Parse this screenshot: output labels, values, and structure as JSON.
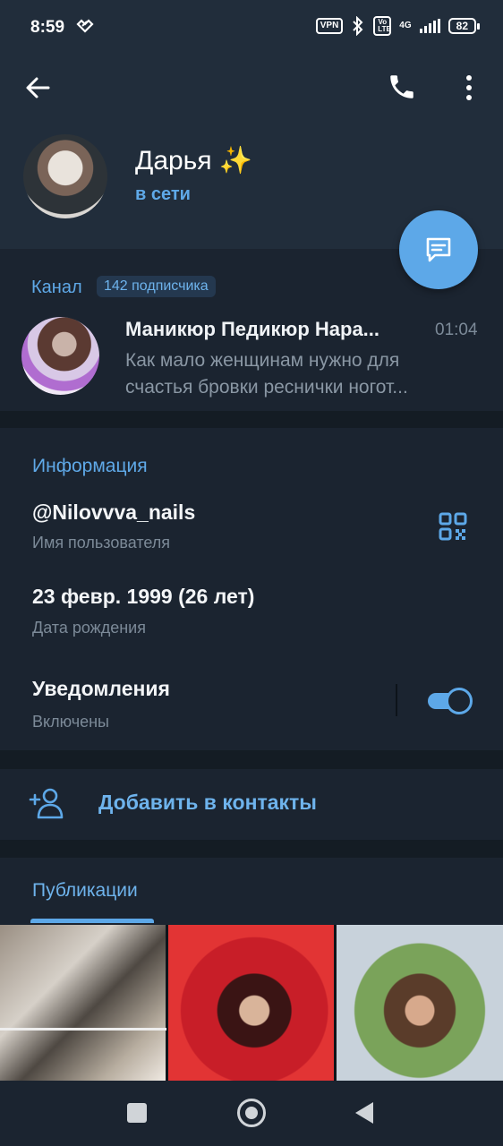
{
  "status_bar": {
    "time": "8:59",
    "vpn": "VPN",
    "volte": "Vo LTE",
    "network": "4G",
    "battery": "82"
  },
  "header": {
    "name": "Дарья ✨",
    "status": "в сети",
    "icons": [
      "back-arrow-icon",
      "phone-icon",
      "more-vert-icon",
      "message-icon"
    ],
    "accent": "#5da8e8"
  },
  "channel": {
    "label": "Канал",
    "subscribers": "142 подписчика",
    "name": "Маникюр Педикюр Нара...",
    "time": "01:04",
    "message": "Как мало женщинам нужно для счастья бровки реснички ногот..."
  },
  "info": {
    "title": "Информация",
    "username": "@Nilovvva_nails",
    "username_label": "Имя пользователя",
    "birthday": "23 февр. 1999 (26 лет)",
    "birthday_label": "Дата рождения",
    "notifications": "Уведомления",
    "notifications_state": "Включены",
    "notifications_on": true
  },
  "add_contact": {
    "label": "Добавить в контакты"
  },
  "publications": {
    "tab": "Публикации"
  }
}
